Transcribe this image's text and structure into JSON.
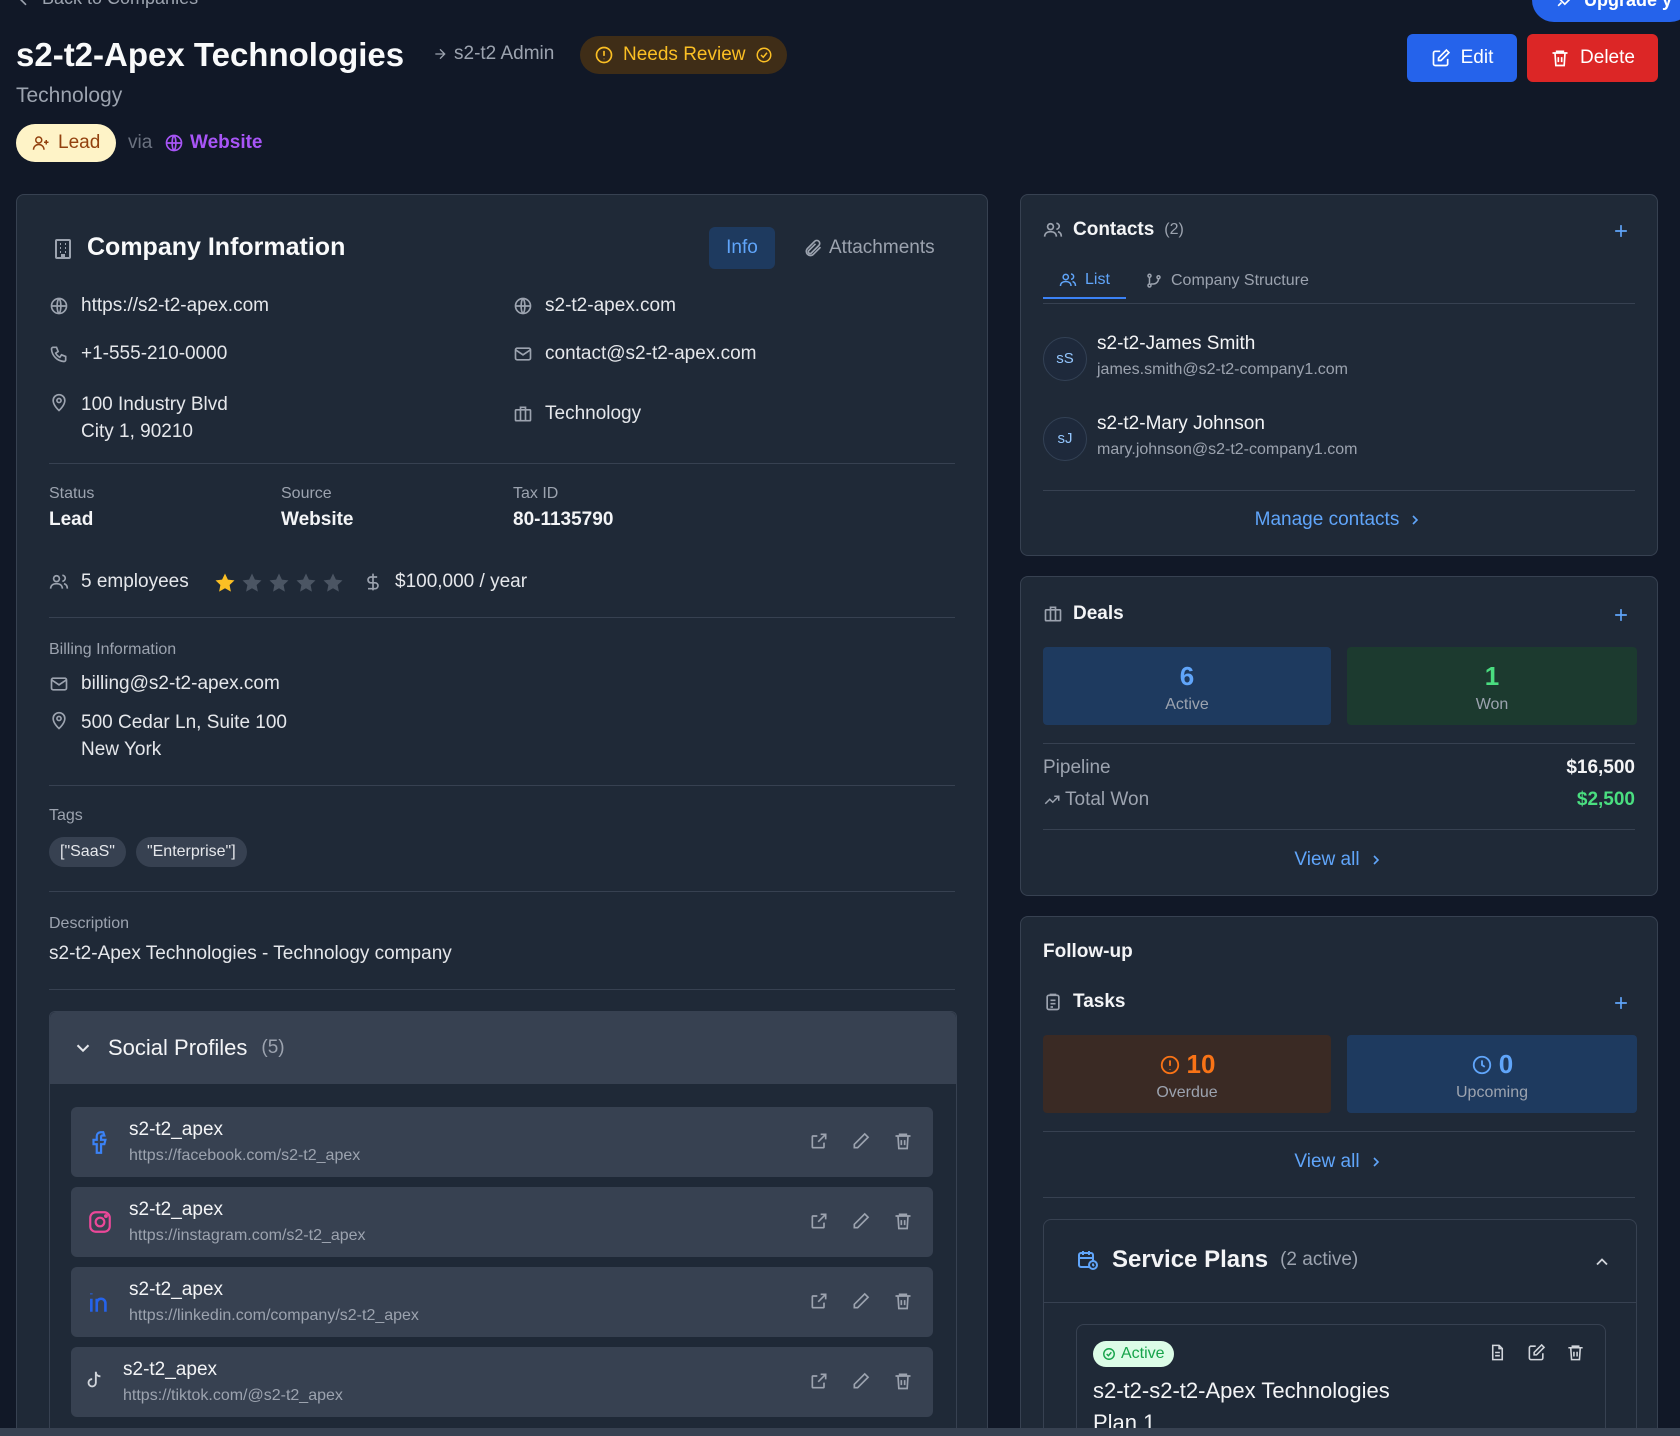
{
  "nav": {
    "back_label": "Back to Companies",
    "upgrade_label": "Upgrade y"
  },
  "header": {
    "title": "s2-t2-Apex Technologies",
    "owner": "s2-t2 Admin",
    "review_badge": "Needs Review",
    "industry": "Technology",
    "status_pill": "Lead",
    "via": "via",
    "source_link": "Website",
    "edit_label": "Edit",
    "delete_label": "Delete"
  },
  "company": {
    "heading": "Company Information",
    "tab_info": "Info",
    "tab_attachments": "Attachments",
    "website": "https://s2-t2-apex.com",
    "domain": "s2-t2-apex.com",
    "phone": "+1-555-210-0000",
    "email": "contact@s2-t2-apex.com",
    "address_line1": "100 Industry Blvd",
    "address_line2": "City 1, 90210",
    "industry": "Technology",
    "status_label": "Status",
    "status_value": "Lead",
    "source_label": "Source",
    "source_value": "Website",
    "taxid_label": "Tax ID",
    "taxid_value": "80-1135790",
    "employees": "5 employees",
    "rating": 1,
    "rating_max": 5,
    "revenue": "$100,000 / year",
    "billing_label": "Billing Information",
    "billing_email": "billing@s2-t2-apex.com",
    "billing_addr1": "500 Cedar Ln, Suite 100",
    "billing_addr2": "New York",
    "tags_label": "Tags",
    "tags": [
      "[\"SaaS\"",
      "\"Enterprise\"]"
    ],
    "description_label": "Description",
    "description": "s2-t2-Apex Technologies - Technology company"
  },
  "social": {
    "heading": "Social Profiles",
    "count": "(5)",
    "items": [
      {
        "name": "s2-t2_apex",
        "url": "https://facebook.com/s2-t2_apex",
        "icon": "facebook-icon"
      },
      {
        "name": "s2-t2_apex",
        "url": "https://instagram.com/s2-t2_apex",
        "icon": "instagram-icon"
      },
      {
        "name": "s2-t2_apex",
        "url": "https://linkedin.com/company/s2-t2_apex",
        "icon": "linkedin-icon"
      },
      {
        "name": "s2-t2_apex",
        "url": "https://tiktok.com/@s2-t2_apex",
        "icon": "tiktok-icon"
      }
    ]
  },
  "contacts": {
    "heading": "Contacts",
    "count": "(2)",
    "tab_list": "List",
    "tab_structure": "Company Structure",
    "people": [
      {
        "initials": "sS",
        "name": "s2-t2-James Smith",
        "email": "james.smith@s2-t2-company1.com"
      },
      {
        "initials": "sJ",
        "name": "s2-t2-Mary Johnson",
        "email": "mary.johnson@s2-t2-company1.com"
      }
    ],
    "manage_label": "Manage contacts"
  },
  "deals": {
    "heading": "Deals",
    "active_count": "6",
    "active_label": "Active",
    "won_count": "1",
    "won_label": "Won",
    "pipeline_label": "Pipeline",
    "pipeline_value": "$16,500",
    "total_won_label": "Total Won",
    "total_won_value": "$2,500",
    "view_all": "View all"
  },
  "followup": {
    "heading": "Follow-up",
    "tasks_heading": "Tasks",
    "overdue_count": "10",
    "overdue_label": "Overdue",
    "upcoming_count": "0",
    "upcoming_label": "Upcoming",
    "view_all": "View all"
  },
  "service_plans": {
    "heading": "Service Plans",
    "count": "(2 active)",
    "plan_status": "Active",
    "plan_name_line1": "s2-t2-s2-t2-Apex Technologies",
    "plan_name_line2": "Plan 1"
  },
  "colors": {
    "background": "#111827",
    "card": "#1f2937",
    "accent_blue": "#2563eb",
    "danger_red": "#dc2626",
    "link": "#60a5fa",
    "success_green": "#4ade80",
    "warning_amber": "#f59e0b"
  }
}
